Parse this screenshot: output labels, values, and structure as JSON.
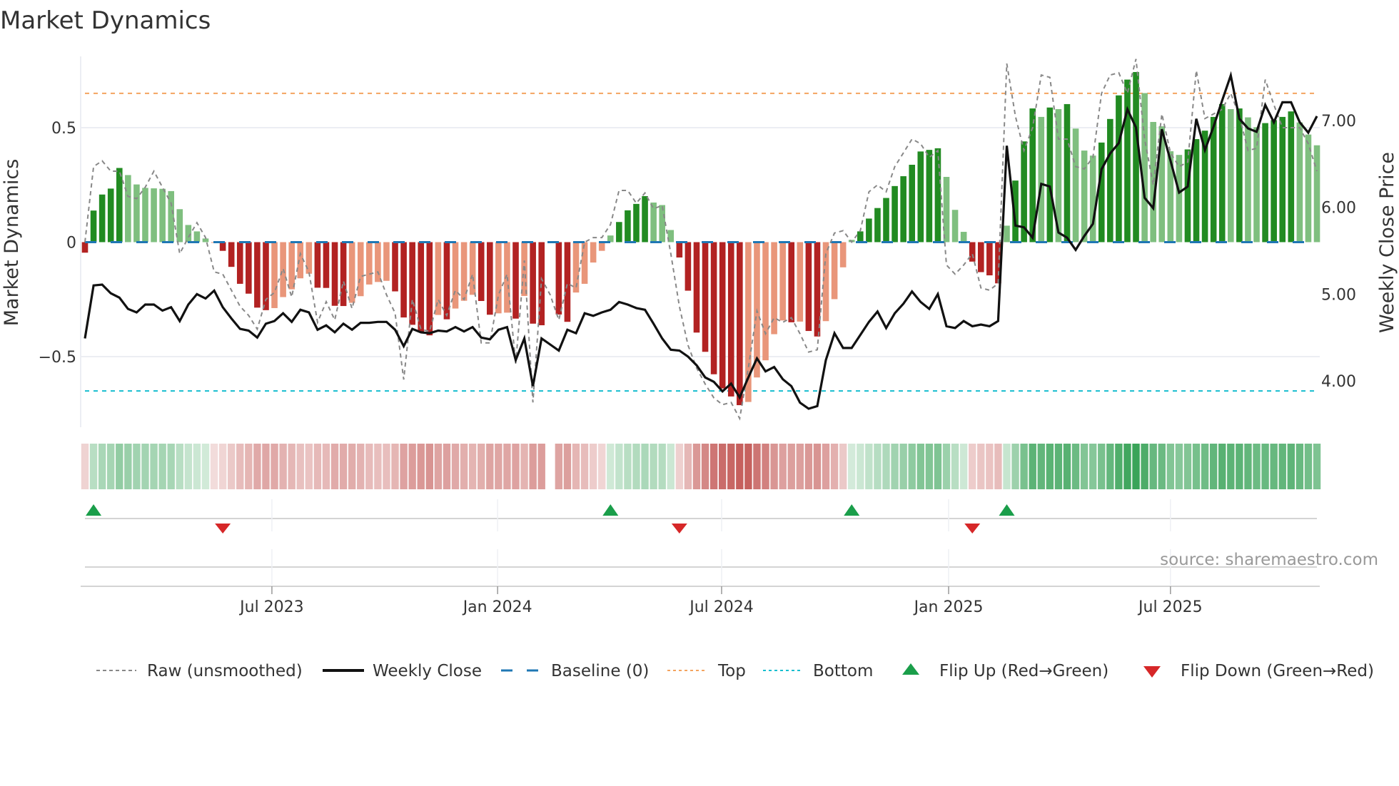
{
  "title": "Market Dynamics",
  "source": "source: sharemaestro.com",
  "colors": {
    "pos_strong": "#228b22",
    "pos_weak": "#7fbf7f",
    "neg_strong": "#b22222",
    "neg_weak": "#e9967a",
    "strip_pos": "#2e9e4f",
    "strip_neg": "#c0504d",
    "raw": "#888888",
    "close": "#111111",
    "baseline": "#1f77b4",
    "top": "#f4a460",
    "bottom": "#17becf",
    "flip_up": "#1a9e4a",
    "flip_down": "#d62728"
  },
  "chart_data": {
    "type": "bar",
    "title": "Market Dynamics",
    "ylabel": "Market Dynamics",
    "y2label": "Weekly Close Price",
    "ylim": [
      -0.82,
      0.8
    ],
    "y2lim": [
      3.55,
      7.87
    ],
    "yticks": [
      {
        "value": 0.5,
        "label": "0.5"
      },
      {
        "value": 0,
        "label": "0"
      },
      {
        "value": -0.5,
        "label": "−0.5"
      }
    ],
    "y2ticks": [
      {
        "value": 7,
        "label": "7.00"
      },
      {
        "value": 6,
        "label": "6.00"
      },
      {
        "value": 5,
        "label": "5.00"
      },
      {
        "value": 4,
        "label": "4.00"
      }
    ],
    "xunit": "week index",
    "xticks": [
      {
        "week": 21.7,
        "label": "Jul 2023"
      },
      {
        "week": 47.9,
        "label": "Jan 2024"
      },
      {
        "week": 73.9,
        "label": "Jul 2024"
      },
      {
        "week": 100.25,
        "label": "Jan 2025"
      },
      {
        "week": 126.0,
        "label": "Jul 2025"
      }
    ],
    "top": 0.65,
    "bottom": -0.65,
    "baseline": 0,
    "momentum": [
      -0.046,
      0.138,
      0.208,
      0.234,
      0.324,
      0.293,
      0.252,
      0.237,
      0.235,
      0.233,
      0.223,
      0.144,
      0.075,
      0.047,
      0.016,
      -0.003,
      -0.038,
      -0.108,
      -0.182,
      -0.225,
      -0.286,
      -0.297,
      -0.288,
      -0.24,
      -0.206,
      -0.158,
      -0.138,
      -0.199,
      -0.2,
      -0.278,
      -0.279,
      -0.265,
      -0.236,
      -0.185,
      -0.174,
      -0.169,
      -0.215,
      -0.329,
      -0.361,
      -0.393,
      -0.407,
      -0.318,
      -0.337,
      -0.29,
      -0.256,
      -0.23,
      -0.257,
      -0.317,
      -0.311,
      -0.308,
      -0.334,
      -0.235,
      -0.356,
      -0.363,
      null,
      -0.316,
      -0.348,
      -0.22,
      -0.182,
      -0.089,
      -0.038,
      0.029,
      0.088,
      0.139,
      0.167,
      0.201,
      0.173,
      0.162,
      0.053,
      -0.067,
      -0.212,
      -0.395,
      -0.479,
      -0.577,
      -0.639,
      -0.674,
      -0.712,
      -0.698,
      -0.591,
      -0.516,
      -0.402,
      -0.342,
      -0.35,
      -0.347,
      -0.388,
      -0.412,
      -0.345,
      -0.249,
      -0.11,
      0.01,
      0.047,
      0.103,
      0.149,
      0.193,
      0.245,
      0.288,
      0.338,
      0.396,
      0.403,
      0.41,
      0.285,
      0.141,
      0.045,
      -0.085,
      -0.131,
      -0.145,
      -0.18,
      0.072,
      0.269,
      0.44,
      0.584,
      0.547,
      0.588,
      0.581,
      0.603,
      0.496,
      0.4,
      0.378,
      0.435,
      0.538,
      0.641,
      0.71,
      0.743,
      0.651,
      0.525,
      0.506,
      0.397,
      0.381,
      0.405,
      0.45,
      0.487,
      0.547,
      0.603,
      0.581,
      0.584,
      0.545,
      0.502,
      0.52,
      0.533,
      0.547,
      0.571,
      0.523,
      0.47,
      0.423
    ],
    "raw": [
      0.0,
      0.33,
      0.355,
      0.31,
      0.31,
      0.2,
      0.19,
      0.24,
      0.31,
      0.24,
      0.17,
      -0.05,
      0.02,
      0.085,
      0.02,
      -0.13,
      -0.14,
      -0.21,
      -0.28,
      -0.32,
      -0.38,
      -0.25,
      -0.22,
      -0.115,
      -0.24,
      -0.05,
      -0.13,
      -0.35,
      -0.26,
      -0.34,
      -0.17,
      -0.29,
      -0.15,
      -0.14,
      -0.13,
      -0.23,
      -0.31,
      -0.6,
      -0.25,
      -0.38,
      -0.39,
      -0.25,
      -0.32,
      -0.21,
      -0.25,
      -0.14,
      -0.44,
      -0.44,
      -0.23,
      -0.14,
      -0.53,
      -0.08,
      -0.7,
      -0.16,
      -0.23,
      -0.34,
      -0.18,
      -0.2,
      0.0,
      0.02,
      0.02,
      0.077,
      0.226,
      0.226,
      0.17,
      0.215,
      0.146,
      0.16,
      -0.05,
      -0.28,
      -0.45,
      -0.55,
      -0.62,
      -0.68,
      -0.71,
      -0.7,
      -0.77,
      -0.55,
      -0.3,
      -0.4,
      -0.33,
      -0.35,
      -0.33,
      -0.4,
      -0.48,
      -0.47,
      -0.05,
      0.04,
      0.05,
      0.0,
      0.05,
      0.22,
      0.25,
      0.22,
      0.33,
      0.39,
      0.45,
      0.43,
      0.37,
      0.4,
      -0.1,
      -0.14,
      -0.1,
      -0.05,
      -0.2,
      -0.21,
      -0.18,
      0.78,
      0.55,
      0.4,
      0.5,
      0.73,
      0.72,
      0.45,
      0.45,
      0.33,
      0.32,
      0.37,
      0.65,
      0.73,
      0.74,
      0.65,
      0.8,
      0.45,
      0.25,
      0.56,
      0.39,
      0.33,
      0.35,
      0.75,
      0.54,
      0.56,
      0.58,
      0.65,
      0.55,
      0.4,
      0.41,
      0.71,
      0.6,
      0.5,
      0.5,
      0.5,
      0.43,
      0.31
    ],
    "weekly_close": [
      4.49,
      5.1,
      5.11,
      5.01,
      4.96,
      4.83,
      4.79,
      4.88,
      4.88,
      4.81,
      4.85,
      4.69,
      4.88,
      5.0,
      4.95,
      5.04,
      4.85,
      4.72,
      4.6,
      4.58,
      4.5,
      4.66,
      4.69,
      4.78,
      4.68,
      4.82,
      4.79,
      4.59,
      4.64,
      4.56,
      4.66,
      4.59,
      4.67,
      4.67,
      4.68,
      4.68,
      4.59,
      4.4,
      4.6,
      4.56,
      4.55,
      4.58,
      4.57,
      4.62,
      4.57,
      4.62,
      4.5,
      4.48,
      4.59,
      4.62,
      4.24,
      4.49,
      3.94,
      4.49,
      4.42,
      4.35,
      4.59,
      4.55,
      4.78,
      4.75,
      4.79,
      4.82,
      4.91,
      4.88,
      4.84,
      4.82,
      4.66,
      4.49,
      4.36,
      4.35,
      4.28,
      4.18,
      4.04,
      3.99,
      3.88,
      3.97,
      3.81,
      4.04,
      4.26,
      4.11,
      4.16,
      4.02,
      3.94,
      3.75,
      3.68,
      3.71,
      4.24,
      4.55,
      4.38,
      4.38,
      4.53,
      4.68,
      4.8,
      4.61,
      4.78,
      4.89,
      5.03,
      4.91,
      4.83,
      5.0,
      4.63,
      4.61,
      4.69,
      4.63,
      4.65,
      4.63,
      4.69,
      6.71,
      5.79,
      5.77,
      5.65,
      6.27,
      6.24,
      5.71,
      5.65,
      5.51,
      5.67,
      5.81,
      6.44,
      6.62,
      6.74,
      7.13,
      6.92,
      6.11,
      5.99,
      6.9,
      6.54,
      6.17,
      6.24,
      7.02,
      6.66,
      6.93,
      7.23,
      7.52,
      7.02,
      6.91,
      6.87,
      7.18,
      6.98,
      7.21,
      7.21,
      6.98,
      6.86,
      7.05
    ],
    "flip_up_weeks": [
      1,
      61,
      89,
      107
    ],
    "flip_down_weeks": [
      16,
      69,
      103
    ],
    "legend": [
      {
        "key": "raw",
        "label": "Raw (unsmoothed)"
      },
      {
        "key": "close",
        "label": "Weekly Close"
      },
      {
        "key": "baseline",
        "label": "Baseline (0)"
      },
      {
        "key": "top",
        "label": "Top"
      },
      {
        "key": "bottom",
        "label": "Bottom"
      },
      {
        "key": "flip_up",
        "label": "Flip Up (Red→Green)"
      },
      {
        "key": "flip_down",
        "label": "Flip Down (Green→Red)"
      }
    ],
    "legend_position": "bottom"
  }
}
